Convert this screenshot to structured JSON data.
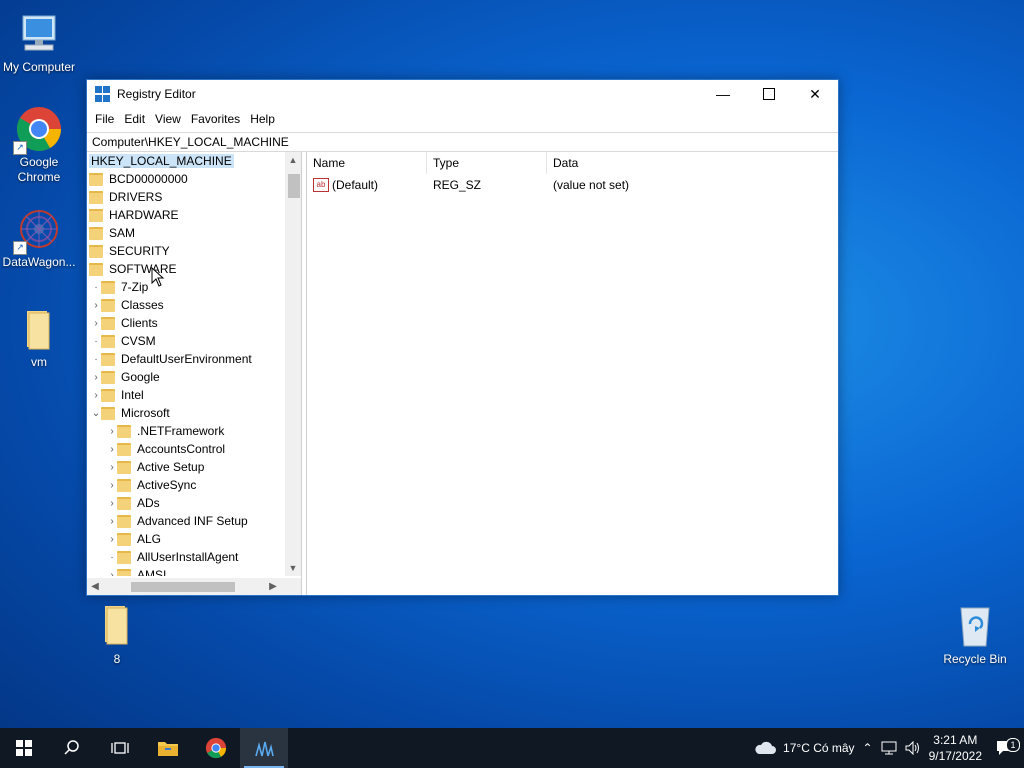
{
  "desktop": {
    "icons": [
      {
        "label": "My Computer",
        "icon": "monitor-icon"
      },
      {
        "label": "Google Chrome",
        "icon": "chrome-icon"
      },
      {
        "label": "DataWagon...",
        "icon": "datawagon-icon"
      },
      {
        "label": "vm",
        "icon": "folder-icon"
      },
      {
        "label": "8",
        "icon": "folder-icon"
      },
      {
        "label": "Recycle Bin",
        "icon": "recycle-bin-icon"
      }
    ]
  },
  "window": {
    "title": "Registry Editor",
    "menu": [
      "File",
      "Edit",
      "View",
      "Favorites",
      "Help"
    ],
    "address": "Computer\\HKEY_LOCAL_MACHINE",
    "tree": [
      {
        "label": "HKEY_LOCAL_MACHINE",
        "level": 0,
        "expander": "",
        "folder": false,
        "selected": true
      },
      {
        "label": "BCD00000000",
        "level": 0,
        "expander": "",
        "folder": true
      },
      {
        "label": "DRIVERS",
        "level": 0,
        "expander": "",
        "folder": true
      },
      {
        "label": "HARDWARE",
        "level": 0,
        "expander": "",
        "folder": true
      },
      {
        "label": "SAM",
        "level": 0,
        "expander": "",
        "folder": true
      },
      {
        "label": "SECURITY",
        "level": 0,
        "expander": "",
        "folder": true
      },
      {
        "label": "SOFTWARE",
        "level": 0,
        "expander": "",
        "folder": true
      },
      {
        "label": "7-Zip",
        "level": 1,
        "expander": "",
        "folder": true
      },
      {
        "label": "Classes",
        "level": 1,
        "expander": ">",
        "folder": true
      },
      {
        "label": "Clients",
        "level": 1,
        "expander": ">",
        "folder": true
      },
      {
        "label": "CVSM",
        "level": 1,
        "expander": "",
        "folder": true
      },
      {
        "label": "DefaultUserEnvironment",
        "level": 1,
        "expander": "",
        "folder": true
      },
      {
        "label": "Google",
        "level": 1,
        "expander": ">",
        "folder": true
      },
      {
        "label": "Intel",
        "level": 1,
        "expander": ">",
        "folder": true
      },
      {
        "label": "Microsoft",
        "level": 1,
        "expander": "v",
        "folder": true
      },
      {
        "label": ".NETFramework",
        "level": 2,
        "expander": ">",
        "folder": true
      },
      {
        "label": "AccountsControl",
        "level": 2,
        "expander": ">",
        "folder": true
      },
      {
        "label": "Active Setup",
        "level": 2,
        "expander": ">",
        "folder": true
      },
      {
        "label": "ActiveSync",
        "level": 2,
        "expander": ">",
        "folder": true
      },
      {
        "label": "ADs",
        "level": 2,
        "expander": ">",
        "folder": true
      },
      {
        "label": "Advanced INF Setup",
        "level": 2,
        "expander": ">",
        "folder": true
      },
      {
        "label": "ALG",
        "level": 2,
        "expander": ">",
        "folder": true
      },
      {
        "label": "AllUserInstallAgent",
        "level": 2,
        "expander": "",
        "folder": true
      },
      {
        "label": "AMSI",
        "level": 2,
        "expander": ">",
        "folder": true
      }
    ],
    "columns": [
      "Name",
      "Type",
      "Data"
    ],
    "values": [
      {
        "name": "(Default)",
        "type": "REG_SZ",
        "data": "(value not set)"
      }
    ]
  },
  "taskbar": {
    "weather": "17°C  Có mây",
    "time": "3:21 AM",
    "date": "9/17/2022",
    "notification_count": "1"
  },
  "colors": {
    "selection": "#cce4f7",
    "taskbar": "#101923",
    "desktop": "#0a66d2"
  }
}
